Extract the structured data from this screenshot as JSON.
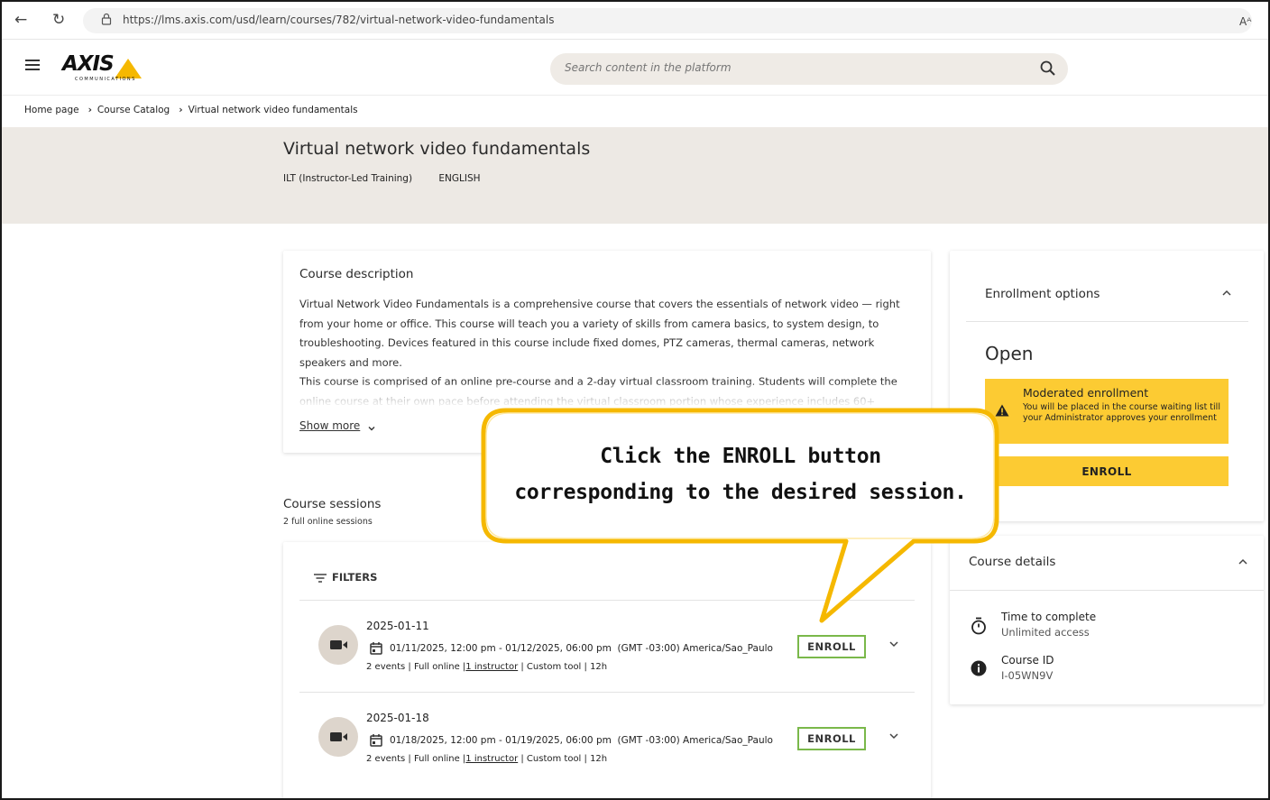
{
  "browser": {
    "url": "https://lms.axis.com/usd/learn/courses/782/virtual-network-video-fundamentals",
    "reader_label": "Aᴬ"
  },
  "header": {
    "logo_text": "AXIS",
    "logo_sub": "COMMUNICATIONS",
    "search_placeholder": "Search content in the platform"
  },
  "breadcrumb": [
    "Home page",
    "Course Catalog",
    "Virtual network video fundamentals"
  ],
  "course": {
    "title": "Virtual network video fundamentals",
    "type": "ILT (Instructor-Led Training)",
    "language": "ENGLISH"
  },
  "description": {
    "title": "Course description",
    "text": "Virtual Network Video Fundamentals is a comprehensive course that covers the essentials of network video — right from your home or office. This course will teach you a variety of skills from camera basics, to system design, to troubleshooting. Devices featured in this course include fixed domes, PTZ cameras, thermal cameras, network speakers and more.\nThis course is comprised of an online pre-course and a 2-day virtual classroom training. Students will complete the online course at their own pace before attending the virtual classroom portion whose experience includes 60+",
    "show_more": "Show more"
  },
  "sessions": {
    "title": "Course sessions",
    "subtitle": "2 full online sessions",
    "filters_label": "FILTERS",
    "items": [
      {
        "date": "2025-01-11",
        "time": "01/11/2025, 12:00 pm - 01/12/2025, 06:00 pm  (GMT -03:00) America/Sao_Paulo",
        "meta_pre": "2 events | Full online |",
        "instructor": "1 instructor",
        "meta_post": " | Custom tool | 12h",
        "enroll_label": "ENROLL"
      },
      {
        "date": "2025-01-18",
        "time": "01/18/2025, 12:00 pm - 01/19/2025, 06:00 pm  (GMT -03:00) America/Sao_Paulo",
        "meta_pre": "2 events | Full online |",
        "instructor": "1 instructor",
        "meta_post": " | Custom tool | 12h",
        "enroll_label": "ENROLL"
      }
    ]
  },
  "enrollment": {
    "title": "Enrollment options",
    "status": "Open",
    "moderated_title": "Moderated enrollment",
    "moderated_text": "You will be placed in the course waiting list till your Administrator approves your enrollment",
    "enroll_label": "ENROLL"
  },
  "details": {
    "title": "Course details",
    "time_label": "Time to complete",
    "time_value": "Unlimited access",
    "id_label": "Course ID",
    "id_value": "I-05WN9V"
  },
  "callout": {
    "line1": "Click the ENROLL button",
    "line2": "corresponding to the desired session."
  },
  "colors": {
    "accent_yellow": "#fccb33",
    "enroll_border_green": "#7ab84a",
    "hero_bg": "#ede9e4",
    "callout_border": "#f5b800"
  }
}
